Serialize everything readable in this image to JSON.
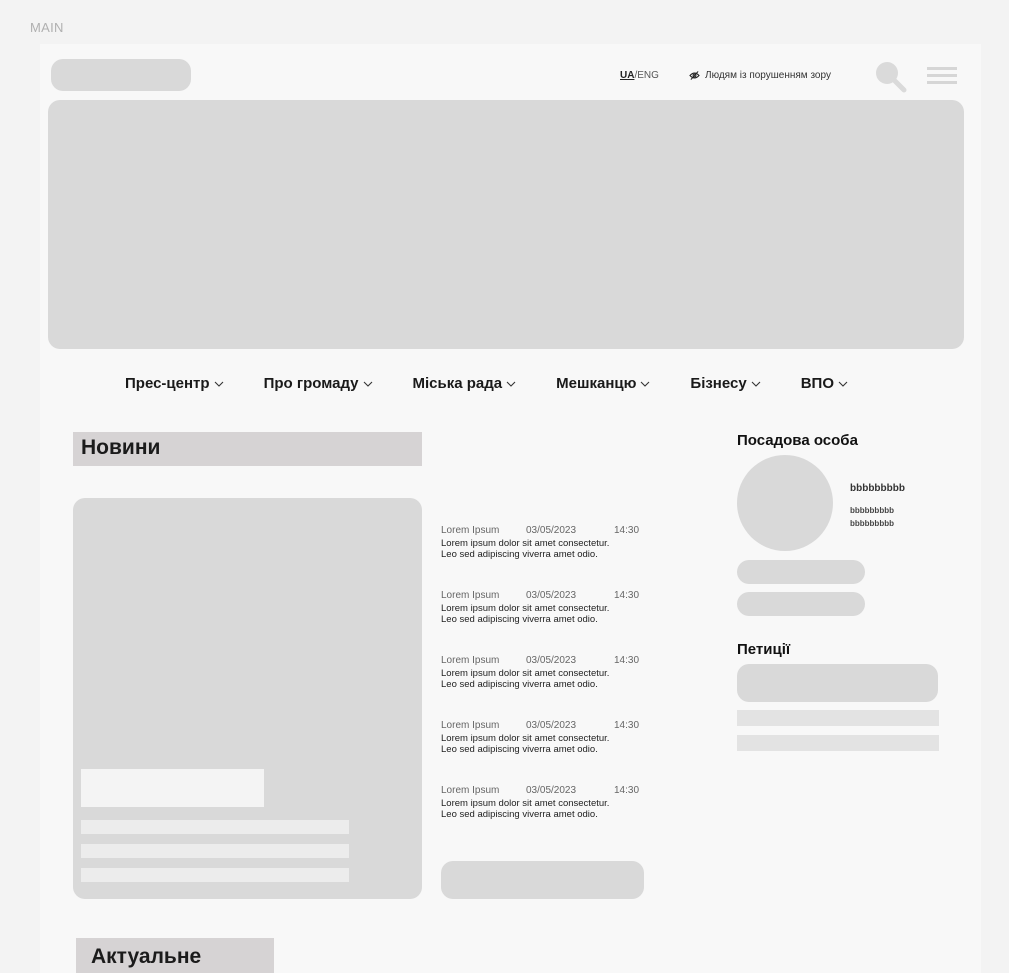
{
  "frame_label": "MAIN",
  "header": {
    "lang_active": "UA",
    "lang_sep": "/",
    "lang_other": "ENG",
    "accessibility": "Людям із порушенням зору"
  },
  "nav": {
    "items": [
      {
        "label": "Прес-центр"
      },
      {
        "label": "Про громаду"
      },
      {
        "label": "Міська рада"
      },
      {
        "label": "Мешканцю"
      },
      {
        "label": "Бізнесу"
      },
      {
        "label": "ВПО"
      }
    ]
  },
  "news": {
    "title": "Новини",
    "items": [
      {
        "source": "Lorem Ipsum",
        "date": "03/05/2023",
        "time": "14:30",
        "line1": "Lorem ipsum dolor sit amet consectetur.",
        "line2": "Leo sed adipiscing viverra amet odio."
      },
      {
        "source": "Lorem Ipsum",
        "date": "03/05/2023",
        "time": "14:30",
        "line1": "Lorem ipsum dolor sit amet consectetur.",
        "line2": "Leo sed adipiscing viverra amet odio."
      },
      {
        "source": "Lorem Ipsum",
        "date": "03/05/2023",
        "time": "14:30",
        "line1": "Lorem ipsum dolor sit amet consectetur.",
        "line2": "Leo sed adipiscing viverra amet odio."
      },
      {
        "source": "Lorem Ipsum",
        "date": "03/05/2023",
        "time": "14:30",
        "line1": "Lorem ipsum dolor sit amet consectetur.",
        "line2": "Leo sed adipiscing viverra amet odio."
      },
      {
        "source": "Lorem Ipsum",
        "date": "03/05/2023",
        "time": "14:30",
        "line1": "Lorem ipsum dolor sit amet consectetur.",
        "line2": "Leo sed adipiscing viverra amet odio."
      }
    ]
  },
  "official": {
    "title": "Посадова особа",
    "name": "bbbbbbbbb",
    "sub1": "bbbbbbbbb",
    "sub2": "bbbbbbbbb"
  },
  "petitions": {
    "title": "Петиції"
  },
  "actual": {
    "title": "Актуальне"
  }
}
